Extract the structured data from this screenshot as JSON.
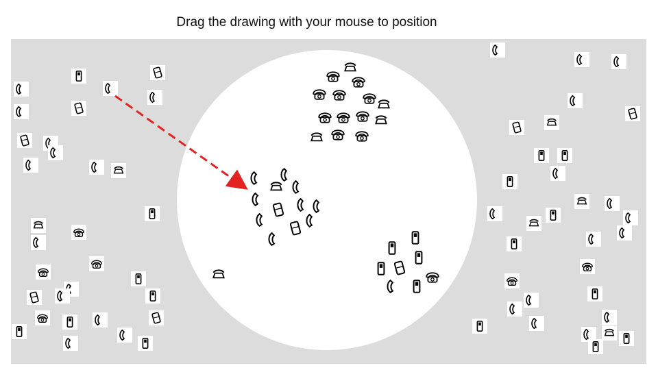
{
  "instruction": "Drag the drawing with your mouse to position",
  "colors": {
    "background": "#dcdcdc",
    "circle": "#ffffff",
    "arrow": "#e32222",
    "ink": "#000000"
  },
  "icons": [
    "handset-icon",
    "mobile-phone-icon",
    "rotary-phone-icon",
    "desk-phone-icon",
    "flip-phone-icon"
  ]
}
